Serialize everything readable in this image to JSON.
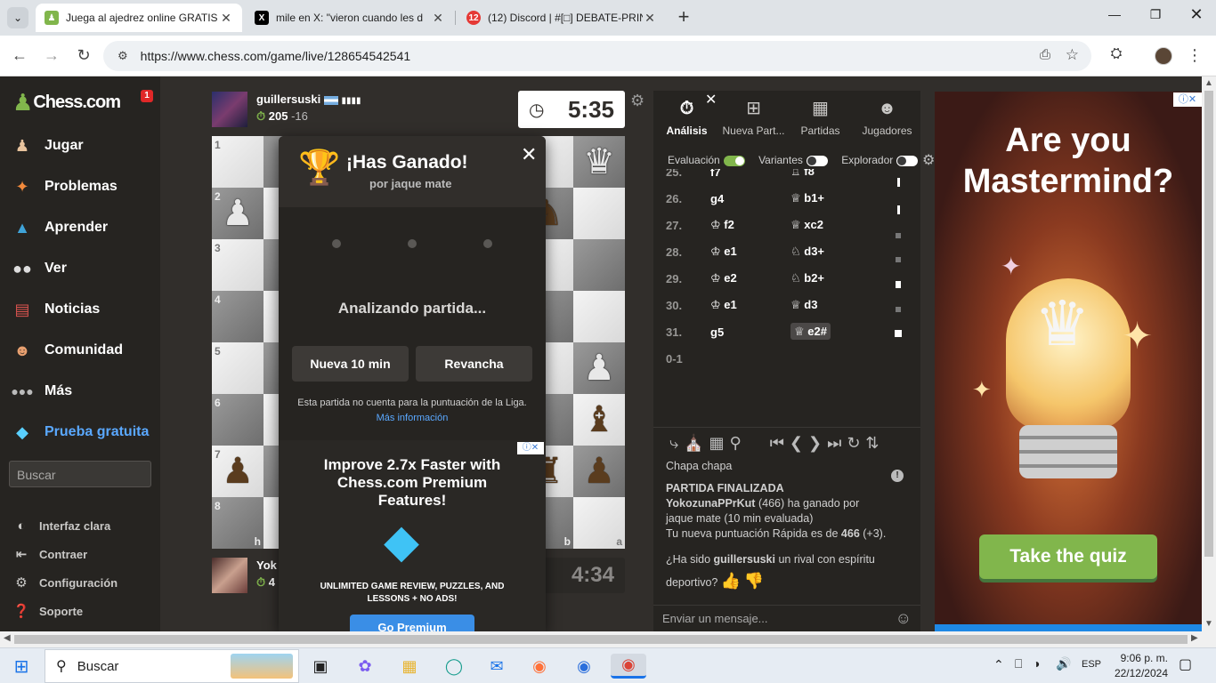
{
  "browser": {
    "tabs": [
      {
        "title": "Juega al ajedrez online GRATIS",
        "active": true
      },
      {
        "title": "mile en X: \"vieron cuando les d",
        "active": false
      },
      {
        "title": "(12) Discord | #[□] DEBATE-PRIN",
        "active": false
      }
    ],
    "discord_badge": "12",
    "new_tab": "+",
    "url": "https://www.chess.com/game/live/128654542541"
  },
  "sidebar": {
    "logo": "Chess.com",
    "notif_count": "1",
    "items": [
      {
        "label": "Jugar",
        "icon": "pawn-hand-icon"
      },
      {
        "label": "Problemas",
        "icon": "puzzle-icon"
      },
      {
        "label": "Aprender",
        "icon": "learn-icon"
      },
      {
        "label": "Ver",
        "icon": "binoculars-icon"
      },
      {
        "label": "Noticias",
        "icon": "news-icon"
      },
      {
        "label": "Comunidad",
        "icon": "community-icon"
      },
      {
        "label": "Más",
        "icon": "more-dots-icon"
      }
    ],
    "trial": "Prueba gratuita",
    "search_placeholder": "Buscar",
    "bottom": [
      {
        "label": "Interfaz clara",
        "icon": "contrast-icon"
      },
      {
        "label": "Contraer",
        "icon": "collapse-icon"
      },
      {
        "label": "Configuración",
        "icon": "gear-icon"
      },
      {
        "label": "Soporte",
        "icon": "help-icon"
      }
    ]
  },
  "top_player": {
    "name": "guillersuski",
    "rating": "205",
    "delta": "-16",
    "clock": "5:35"
  },
  "bottom_player": {
    "name": "Yok",
    "rating": "4",
    "clock": "4:34"
  },
  "board": {
    "ranks": [
      "1",
      "2",
      "3",
      "4",
      "5",
      "6",
      "7",
      "8"
    ],
    "files_bottom": [
      "h",
      "b",
      "a"
    ]
  },
  "modal": {
    "title": "¡Has Ganado!",
    "subtitle": "por jaque mate",
    "analyzing": "Analizando partida...",
    "btn_new": "Nueva 10 min",
    "btn_rematch": "Revancha",
    "note": "Esta partida no cuenta para la puntuación de la Liga.",
    "more_info": "Más información",
    "promo_title": "Improve 2.7x Faster with Chess.com Premium Features!",
    "promo_sub": "UNLIMITED GAME REVIEW, PUZZLES, AND LESSONS + NO ADS!",
    "promo_btn": "Go Premium"
  },
  "panel": {
    "tabs": [
      {
        "label": "Análisis",
        "icon": "stopwatch-icon"
      },
      {
        "label": "Nueva Part...",
        "icon": "plus-square-icon"
      },
      {
        "label": "Partidas",
        "icon": "board-icon"
      },
      {
        "label": "Jugadores",
        "icon": "players-icon"
      }
    ],
    "toggles": [
      {
        "label": "Evaluación",
        "on": true
      },
      {
        "label": "Variantes",
        "on": false
      },
      {
        "label": "Explorador",
        "on": false
      }
    ],
    "moves": [
      {
        "num": "25.",
        "white": "f7",
        "black": "♖ f8"
      },
      {
        "num": "26.",
        "white": "g4",
        "black": "♕ b1+"
      },
      {
        "num": "27.",
        "white": "♔ f2",
        "black": "♕ xc2"
      },
      {
        "num": "28.",
        "white": "♔ e1",
        "black": "♘ d3+"
      },
      {
        "num": "29.",
        "white": "♔ e2",
        "black": "♘ b2+"
      },
      {
        "num": "30.",
        "white": "♔ e1",
        "black": "♕ d3"
      },
      {
        "num": "31.",
        "white": "g5",
        "black": "♕ e2#"
      }
    ],
    "result": "0-1",
    "chat": {
      "line1": "Chapa chapa",
      "header": "PARTIDA FINALIZADA",
      "winner": "YokozunaPPrKut",
      "winner_rest": "(466) ha ganado por jaque mate (10 min evaluada)",
      "rating_pre": "Tu nueva puntuación Rápida es de",
      "rating_val": "466",
      "rating_post": "(+3).",
      "q_pre": "¿Ha sido",
      "q_name": "guillersuski",
      "q_post": "un rival con espíritu deportivo?",
      "placeholder": "Enviar un mensaje..."
    }
  },
  "ad": {
    "headline": "Are you Mastermind?",
    "cta": "Take the quiz"
  },
  "taskbar": {
    "search": "Buscar",
    "lang": "ESP",
    "time": "9:06 p. m.",
    "date": "22/12/2024"
  },
  "colors": {
    "green": "#81b64c",
    "brand_blue": "#5aa8ff",
    "dark_bg": "#312e2b"
  }
}
